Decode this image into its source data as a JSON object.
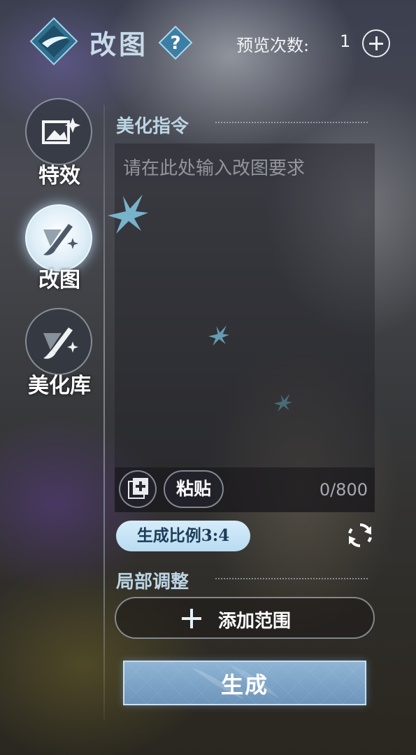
{
  "header": {
    "title": "改图",
    "preview_label": "预览次数:",
    "preview_count": "1"
  },
  "nav": {
    "items": [
      {
        "label": "特效",
        "icon": "image-sparkle-icon",
        "active": false
      },
      {
        "label": "改图",
        "icon": "magic-brush-icon",
        "active": true
      },
      {
        "label": "美化库",
        "icon": "magic-brush-icon",
        "active": false
      }
    ]
  },
  "instruction": {
    "section_title": "美化指令",
    "placeholder": "请在此处输入改图要求",
    "paste_label": "粘贴",
    "counter": "0/800"
  },
  "ratio": {
    "label": "生成比例3:4"
  },
  "local_adjust": {
    "section_title": "局部调整",
    "add_range_label": "添加范围"
  },
  "generate": {
    "label": "生成"
  },
  "colors": {
    "accent": "#bcd5e4",
    "ratio_pill": "#c9e4f6",
    "generate_button": "#7ea5c8"
  }
}
